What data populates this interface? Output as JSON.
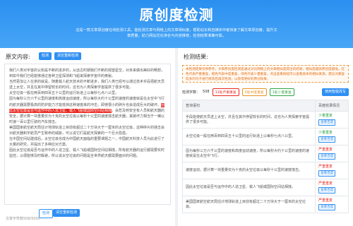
{
  "hero": {
    "title": "原创度检测",
    "desc": "这是一款文章原创度在线检测工具，能检测文章与网络上的文章相似度，帮助站长和自媒体作者快速了解文章原创度，提升文章质量，助力网站优化排名与内容推荐，检测结果准确可靠。"
  },
  "left": {
    "title": "原文内容:",
    "detect_btn": "检测",
    "clear_btn": "清空重新检测",
    "bottom_detect_btn": "检测",
    "bottom_clear_btn": "清空重新检测",
    "paragraphs": [
      {
        "before": "我们人类对宇宙的认知是不断的进步的，从远古时期我们不断的观望星空，对未来做出美好的畅想，到如今我们已经能够通过各种卫星探测和飞船来探索宇宙中的奥秘。",
        "hl": "",
        "after": ""
      },
      {
        "before": "当然更加让人在意的就是，随着载人航天技术的不断进步，我们人类已经可以通过技术手段把航天员送上太空，并且在其中停留较长的时间，这也为人类探索宇宙提供了很多可能。",
        "hl": "",
        "after": ""
      },
      {
        "before": "太空垃圾一般在两百到四百五十公里的运行轨道上以每秒七点八公里。",
        "hl": "",
        "after": ""
      },
      {
        "before": "因为每秒三万六千公里的速度和高度运动速度，所以每秒大约十公里的速度的速度就是在太空中飞行的航天器需要极高的防护能力才能抵挡这种速度来的冲击，即使很小的碎片也会造成巨大的破坏。",
        "hl": "因此太空垃圾是否与运作中的人造卫星、载人飞船或国际空间站相撞",
        "after": "，会危及到安全有人员和航天器的安全，据计算一块重量仅为十克的太空垃圾以每秒十公里的速度撞击航天器，其破坏力相当于一辆以时速一百公里行驶的汽车撞击。"
      },
      {
        "before": "美国国家航空航天局估计地球轨道上目前有超过二十万块大于一厘米的太空垃圾，这种碎片的撞击会对航天器和宇航员产生致命的威胁，可以说它们是航天探索的一个巨大隐患。",
        "hl": "",
        "after": ""
      },
      {
        "before": "在中国空间站建成后，太空垃圾也成为中国航天面临的重要课题之一，中国航天科技人员为此进行了大量的研究，并提出了多种应对方案。",
        "hl": "",
        "after": ""
      },
      {
        "before": "因此太空垃圾是否与运作中的人造卫星、载人飞船或国际空间站相撞，所有航天器的运行都需要实时监控，以便能够及时躲避，所以说太空垃圾的问题是全世界航天都需要面对的问题。",
        "hl": "",
        "after": ""
      }
    ],
    "word_count": "文章字符数508/5000"
  },
  "right": {
    "title": "检测结果:",
    "notice": "本检测结果仅供参考，文章原创度检测是通过对比网络上的文章相似度得出的结果，相似度越高原创度越低。红色代表严重重复，橙色代表中度重复，绿色代表少量重复，点击查看按钮可以查看具体的相似来源，建议对重复较多的句子进行修改后再次检测，以获得更好的原创效果。",
    "stats": {
      "label": "检测字数：",
      "count": "508",
      "serious": "11处严重重复",
      "medium": "0处中度重复",
      "light": "1处少量重复"
    },
    "rewrite_btn": "使用智能改写",
    "headers": [
      "查询语句",
      "百度收录情况"
    ],
    "rows": [
      {
        "sentence": "手段能使航天员送上太空，并且在其中停留较长的时间，这也为人类探索宇宙提供了很多可能。",
        "status": "少量重复",
        "color": "green",
        "view": "查看百度"
      },
      {
        "sentence": "太空垃圾一般在两百到四百五十公里的运行轨道上以每秒七点八公里。",
        "status": "少量重复",
        "color": "green",
        "view": "查看百度"
      },
      {
        "sentence": "因为每秒三万六千公里的速度和高度运动速度，所以每秒大约十公里的速度的速度就是在太空中飞行。",
        "status": "严重重复",
        "color": "red",
        "view": "查看百度"
      },
      {
        "sentence": "速度运动，据计算一块重量仅为十克的太空垃圾以每秒十公里的速度撞击。",
        "status": "严重重复",
        "color": "red",
        "view": "查看百度"
      },
      {
        "sentence": "因此太空垃圾是否与运作中的人造卫星、载人飞船或国际空间站相撞。",
        "status": "严重重复",
        "color": "red",
        "view": "查看百度"
      },
      {
        "sentence": "美国国家航空航天局估计地球轨道上目前有超过二十万块大于一厘米的太空垃圾。",
        "status": "严重重复",
        "color": "red",
        "view": "查看百度"
      }
    ]
  }
}
